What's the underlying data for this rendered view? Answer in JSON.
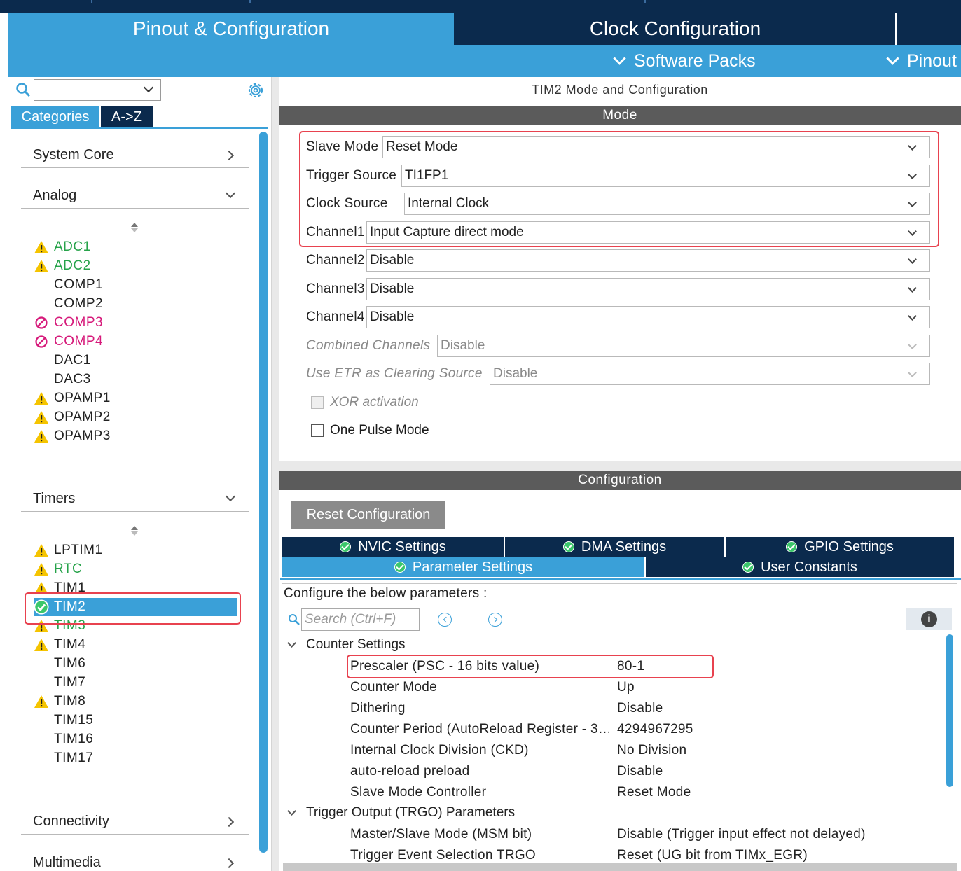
{
  "main_tabs": {
    "pinout_config": "Pinout & Configuration",
    "clock_config": "Clock Configuration"
  },
  "sub_menu": {
    "software_packs": "Software Packs",
    "pinout": "Pinout"
  },
  "left": {
    "search_placeholder": "",
    "tabs": {
      "categories": "Categories",
      "a_to_z": "A->Z"
    },
    "sections": {
      "system_core": "System Core",
      "analog": "Analog",
      "timers": "Timers",
      "connectivity": "Connectivity",
      "multimedia": "Multimedia"
    },
    "analog_items": [
      {
        "label": "ADC1",
        "status": "warning"
      },
      {
        "label": "ADC2",
        "status": "warning"
      },
      {
        "label": "COMP1",
        "status": "none"
      },
      {
        "label": "COMP2",
        "status": "none"
      },
      {
        "label": "COMP3",
        "status": "blocked"
      },
      {
        "label": "COMP4",
        "status": "blocked"
      },
      {
        "label": "DAC1",
        "status": "none"
      },
      {
        "label": "DAC3",
        "status": "none"
      },
      {
        "label": "OPAMP1",
        "status": "warning"
      },
      {
        "label": "OPAMP2",
        "status": "warning"
      },
      {
        "label": "OPAMP3",
        "status": "warning"
      }
    ],
    "timer_items": [
      {
        "label": "LPTIM1",
        "status": "warning"
      },
      {
        "label": "RTC",
        "status": "warning"
      },
      {
        "label": "TIM1",
        "status": "warning"
      },
      {
        "label": "TIM2",
        "status": "ok",
        "selected": true
      },
      {
        "label": "TIM3",
        "status": "warning"
      },
      {
        "label": "TIM4",
        "status": "warning"
      },
      {
        "label": "TIM6",
        "status": "none"
      },
      {
        "label": "TIM7",
        "status": "none"
      },
      {
        "label": "TIM8",
        "status": "warning"
      },
      {
        "label": "TIM15",
        "status": "none"
      },
      {
        "label": "TIM16",
        "status": "none"
      },
      {
        "label": "TIM17",
        "status": "none"
      }
    ]
  },
  "right": {
    "title": "TIM2 Mode and Configuration",
    "mode_header": "Mode",
    "mode_rows": {
      "slave_mode": {
        "label": "Slave Mode",
        "value": "Reset Mode"
      },
      "trigger_source": {
        "label": "Trigger Source",
        "value": "TI1FP1"
      },
      "clock_source": {
        "label": "Clock Source",
        "value": "Internal Clock"
      },
      "channel1": {
        "label": "Channel1",
        "value": "Input Capture direct mode"
      },
      "channel2": {
        "label": "Channel2",
        "value": "Disable"
      },
      "channel3": {
        "label": "Channel3",
        "value": "Disable"
      },
      "channel4": {
        "label": "Channel4",
        "value": "Disable"
      },
      "combined": {
        "label": "Combined Channels",
        "value": "Disable"
      },
      "etr": {
        "label": "Use ETR as Clearing Source",
        "value": "Disable"
      }
    },
    "checkboxes": {
      "xor": "XOR activation",
      "one_pulse": "One Pulse Mode"
    },
    "config_header": "Configuration",
    "reset_button": "Reset Configuration",
    "config_tabs": {
      "nvic": "NVIC Settings",
      "dma": "DMA Settings",
      "gpio": "GPIO Settings",
      "parameter": "Parameter Settings",
      "user_constants": "User Constants"
    },
    "configure_label": "Configure the below parameters :",
    "search_placeholder": "Search (Ctrl+F)",
    "info_glyph": "i",
    "groups": {
      "counter": "Counter Settings",
      "trgo": "Trigger Output (TRGO) Parameters"
    },
    "counter_params": [
      {
        "name": "Prescaler (PSC - 16 bits value)",
        "value": "80-1"
      },
      {
        "name": "Counter Mode",
        "value": "Up"
      },
      {
        "name": "Dithering",
        "value": "Disable"
      },
      {
        "name": "Counter Period (AutoReload Register - 3…",
        "value": "4294967295"
      },
      {
        "name": "Internal Clock Division (CKD)",
        "value": "No Division"
      },
      {
        "name": "auto-reload preload",
        "value": "Disable"
      },
      {
        "name": "Slave Mode Controller",
        "value": "Reset Mode"
      }
    ],
    "trgo_params": [
      {
        "name": "Master/Slave Mode (MSM bit)",
        "value": "Disable (Trigger input effect not delayed)"
      },
      {
        "name": "Trigger Event Selection TRGO",
        "value": "Reset (UG bit from TIMx_EGR)"
      }
    ]
  },
  "colors": {
    "accent": "#3aa0d8",
    "navy": "#0b2a4d",
    "warning": "#f5c400",
    "ok_green": "#3cc76b",
    "blocked_pink": "#d6197a",
    "highlight_red": "#e8424f"
  }
}
